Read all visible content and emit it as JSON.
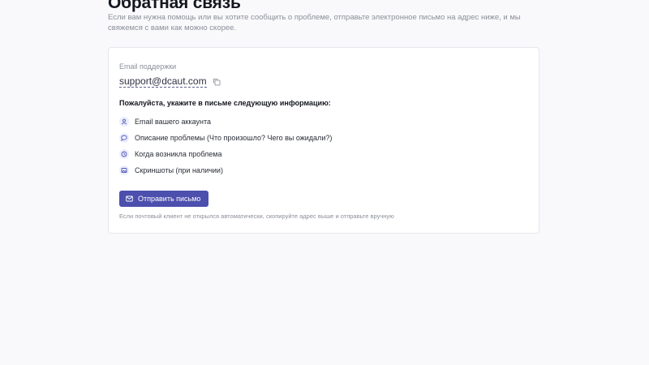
{
  "header": {
    "title": "Обратная связь",
    "subtitle": "Если вам нужна помощь или вы хотите сообщить о проблеме, отправьте электронное письмо на адрес ниже, и мы свяжемся с вами как можно скорее."
  },
  "support": {
    "label": "Email поддержки",
    "email": "support@dcaut.com",
    "copy_icon": "copy-icon"
  },
  "info": {
    "heading": "Пожалуйста, укажите в письме следующую информацию:",
    "items": [
      {
        "icon": "user-icon",
        "label": "Email вашего аккаунта"
      },
      {
        "icon": "message-bubble-icon",
        "label": "Описание проблемы (Что произошло? Чего вы ожидали?)"
      },
      {
        "icon": "clock-icon",
        "label": "Когда возникла проблема"
      },
      {
        "icon": "image-icon",
        "label": "Скриншоты (при наличии)"
      }
    ]
  },
  "action": {
    "button_label": "Отправить письмо",
    "button_icon": "mail-icon",
    "footnote": "Если почтовый клиент не открылся автоматически, скопируйте адрес выше и отправьте вручную"
  },
  "colors": {
    "accent": "#4c4fad",
    "icon_bg": "#eceefe",
    "muted_text": "#8b8f99",
    "page_bg": "#f9f9fb"
  }
}
